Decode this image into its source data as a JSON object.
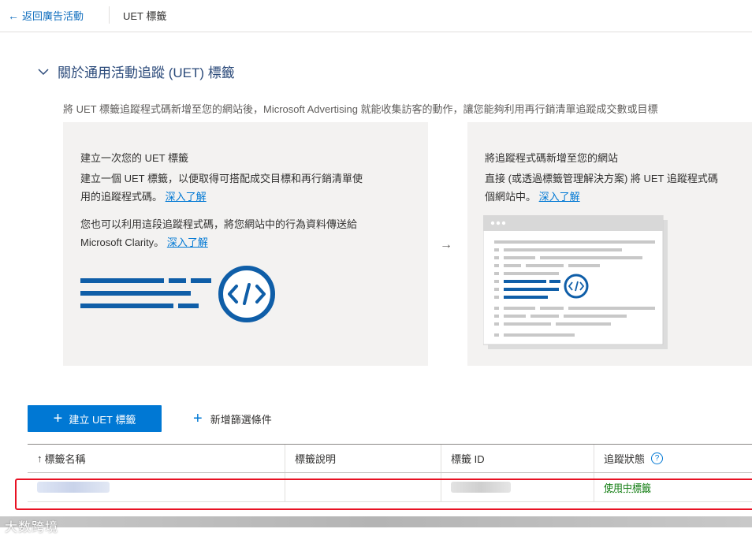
{
  "topbar": {
    "back_label": "返回廣告活動",
    "title": "UET 標籤"
  },
  "section": {
    "title": "關於通用活動追蹤 (UET) 標籤",
    "description": "將 UET 標籤追蹤程式碼新增至您的網站後，Microsoft Advertising 就能收集訪客的動作，讓您能夠利用再行銷清單追蹤成交數或目標"
  },
  "card_create": {
    "title": "建立一次您的 UET 標籤",
    "text1_line1": "建立一個 UET 標籤，以便取得可搭配成交目標和再行銷清單使",
    "text1_line2": "用的追蹤程式碼。",
    "link1": "深入了解",
    "text2_line1": "您也可以利用這段追蹤程式碼，將您網站中的行為資料傳送給",
    "text2_line2": "Microsoft Clarity。",
    "link2": "深入了解",
    "illustration": "code-icon"
  },
  "card_add": {
    "title": "將追蹤程式碼新增至您的網站",
    "text_line1": "直接 (或透過標籤管理解決方案) 將 UET 追蹤程式碼",
    "text_line2": "個網站中。",
    "link": "深入了解",
    "illustration": "browser-code-icon"
  },
  "toolbar": {
    "create_label": "建立 UET 標籤",
    "filter_label": "新增篩選條件"
  },
  "table": {
    "columns": [
      "標籤名稱",
      "標籤說明",
      "標籤 ID",
      "追蹤狀態"
    ],
    "help_icon": "?",
    "rows": [
      {
        "name": "",
        "description": "",
        "id": "",
        "status": "使用中標籤"
      }
    ]
  },
  "watermark": "大数跨境",
  "colors": {
    "accent": "#0078d4",
    "status_active": "#107c10",
    "highlight": "#e81123",
    "card_bg": "#f3f2f1"
  }
}
